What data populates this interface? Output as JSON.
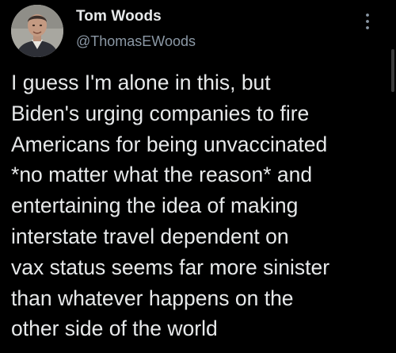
{
  "tweet": {
    "author": {
      "display_name": "Tom Woods",
      "handle": "@ThomasEWoods",
      "avatar_icon": "profile-photo"
    },
    "more_icon": "more-vertical-icon",
    "text": "I guess I'm alone in this, but\nBiden's urging companies to fire\nAmericans for being unvaccinated\n*no matter what the reason* and\nentertaining the idea of making\ninterstate travel dependent on\nvax status seems far more sinister\nthan whatever happens on the\nother side of the world"
  },
  "colors": {
    "background": "#000000",
    "text_primary": "#e7e9ea",
    "text_secondary": "#8b98a5"
  }
}
